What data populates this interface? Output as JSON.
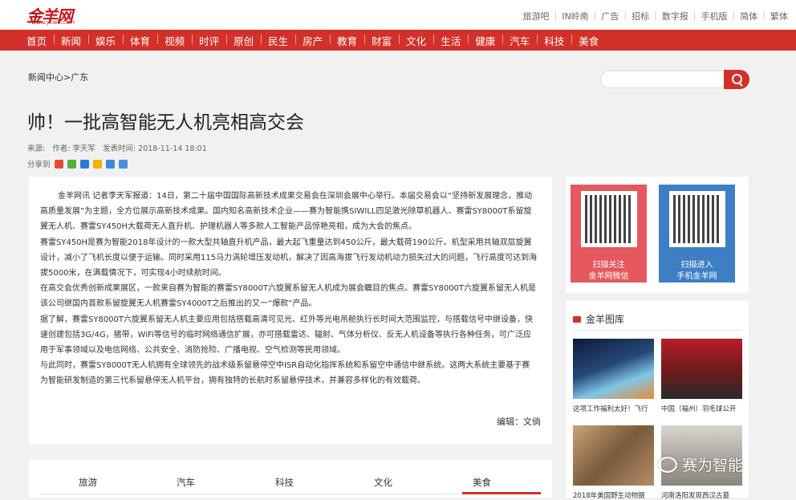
{
  "logo": {
    "mark": "金羊网",
    "url": "www.ycwb.com"
  },
  "top_links": [
    "旅游吧",
    "IN岭南",
    "广告",
    "招标",
    "数字报",
    "手机版",
    "简体",
    "繁体"
  ],
  "nav": [
    "首页",
    "新闻",
    "娱乐",
    "体育",
    "视频",
    "时评",
    "原创",
    "民生",
    "房产",
    "教育",
    "财富",
    "文化",
    "生活",
    "健康",
    "汽车",
    "科技",
    "美食"
  ],
  "breadcrumb": "新闻中心>广东",
  "search": {
    "placeholder": ""
  },
  "article": {
    "title": "帅！一批高智能无人机亮相高交会",
    "source_label": "来源:",
    "author": "作者: 李天军",
    "time": "发表时间: 2018-11-14 18:01",
    "share_label": "分享到",
    "paragraphs": [
      "金羊网讯 记者李天军报道：14日，第二十届中国国际高新技术成果交易会在深圳会展中心举行。本届交易会以“坚持新发展理念，推动高质量发展”为主题，全方位展示高新技术成果。国内知名高新技术企业——赛为智能携SIWILL四足激光除草机器人、赛雷SY8000T系留旋翼无人机、赛雷SY450H大载荷无人直升机、护理机器人等多款人工智能产品惊艳亮相，成为大会的焦点。",
      "赛雷SY450H是赛为智能2018年设计的一款大型共轴直升机产品，最大起飞重量达到450公斤，最大载荷190公斤。机型采用共轴双层旋翼设计，减小了飞机长度以便于运输。同时采用115马力涡轮增压发动机，解决了因高海拔飞行发动机动力损失过大的问题，飞行高度可达到海拔5000米，在满载情况下，可实现4小时续航时间。",
      "在高交会优秀创新成果展区，一款来自赛为智能的赛雷SY8000T六旋翼系留无人机成为展会瞩目的焦点。赛雷SY8000T六旋翼系留无人机是该公司继国内首款系留旋翼无人机赛雷SY4000T之后推出的又一“爆款”产品。",
      "据了解，赛雷SY8000T六旋翼系留无人机主要应用包括搭载高清可见光、红外等光电吊舱执行长时间大范围监控，与搭载信号中继设备，快速创建包括3G/4G，猪带，WiFi等信号的临时网络通信扩展，亦可搭载雷达、辐射、气体分析仪、反无人机设备等执行各种任务，可广泛应用于军事领域以及电信网络、公共安全、消防抢险、广播电视、空气检测等民用领域。",
      "与此同时，赛雷SY8000T无人机拥有全球领先的战术级系留悬停空中ISR自动化指挥系统和系留空中通信中继系统。这两大系统主要基于赛为智能研发制造的第三代系留悬停无人机平台，拥有独特的长航时系留悬停技术，并兼容多样化的有效载荷。"
    ],
    "editor": "编辑：文倘"
  },
  "qr": [
    {
      "line1": "扫描关注",
      "line2": "金羊网微信"
    },
    {
      "line1": "扫描进入",
      "line2": "手机金羊网"
    }
  ],
  "gallery": {
    "title": "金羊图库",
    "items": [
      {
        "caption": "这项工作福利太好！飞行"
      },
      {
        "caption": "中国（福州）羽毛球公开"
      },
      {
        "caption": "2018年美国野生动物摄"
      },
      {
        "caption": "河南洛阳发现西汉古墓"
      }
    ]
  },
  "tabs": [
    "旅游",
    "汽车",
    "科技",
    "文化",
    "美食"
  ],
  "watermark": "赛为智能",
  "colors": {
    "brand_red": "#d3302a",
    "qr_red": "#e4585e",
    "qr_blue": "#3e7ec4"
  }
}
